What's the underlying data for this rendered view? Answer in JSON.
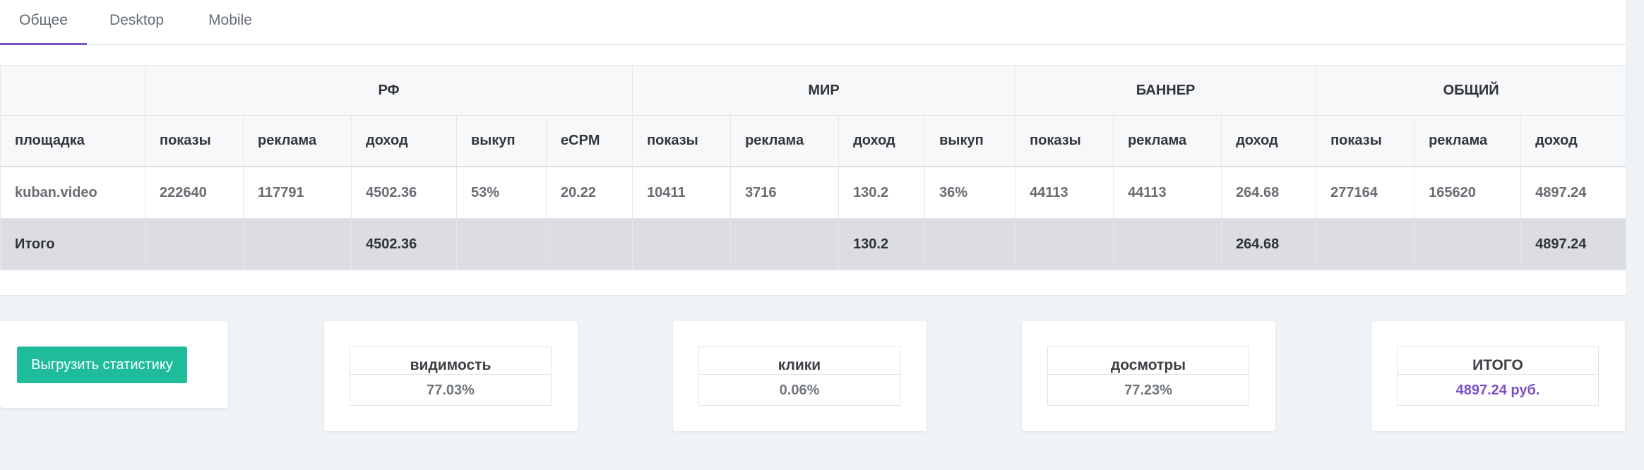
{
  "tabs": [
    {
      "label": "Общее",
      "active": true
    },
    {
      "label": "Desktop",
      "active": false
    },
    {
      "label": "Mobile",
      "active": false
    }
  ],
  "table": {
    "groups": [
      "РФ",
      "МИР",
      "БАННЕР",
      "ОБЩИЙ"
    ],
    "columns": [
      "площадка",
      "показы",
      "реклама",
      "доход",
      "выкуп",
      "eCPM",
      "показы",
      "реклама",
      "доход",
      "выкуп",
      "показы",
      "реклама",
      "доход",
      "показы",
      "реклама",
      "доход"
    ],
    "rows": [
      [
        "kuban.video",
        "222640",
        "117791",
        "4502.36",
        "53%",
        "20.22",
        "10411",
        "3716",
        "130.2",
        "36%",
        "44113",
        "44113",
        "264.68",
        "277164",
        "165620",
        "4897.24"
      ]
    ],
    "total": [
      "Итого",
      "",
      "",
      "4502.36",
      "",
      "",
      "",
      "",
      "130.2",
      "",
      "",
      "",
      "264.68",
      "",
      "",
      "4897.24"
    ]
  },
  "export_button": "Выгрузить статистику",
  "metrics": [
    {
      "label": "видимость",
      "value": "77.03%"
    },
    {
      "label": "клики",
      "value": "0.06%"
    },
    {
      "label": "досмотры",
      "value": "77.23%"
    },
    {
      "label": "ИТОГО",
      "value": "4897.24 руб."
    }
  ],
  "colors": {
    "accent": "#7b4fc7",
    "button": "#1fbc9c",
    "background": "#f0f3f6"
  }
}
